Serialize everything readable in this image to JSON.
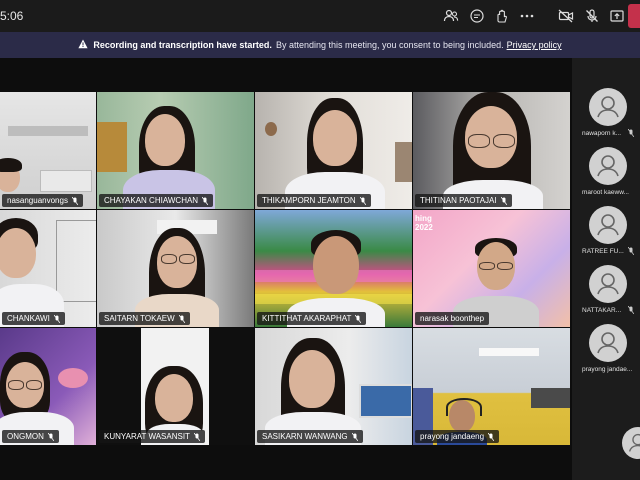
{
  "meeting": {
    "timer": "5:06",
    "banner_title": "Recording and transcription have started.",
    "banner_text": "By attending this meeting, you consent to being included.",
    "banner_link": "Privacy policy"
  },
  "toolbar": {
    "icons": [
      "people-icon",
      "chat-icon",
      "react-icon",
      "more-icon",
      "camera-off-icon",
      "mic-off-icon",
      "share-icon"
    ]
  },
  "tiles": [
    {
      "name": "nasanguanvongs"
    },
    {
      "name": "CHAYAKAN CHIAWCHAN"
    },
    {
      "name": "THIKAMPORN JEAMTON"
    },
    {
      "name": "THITINAN PAOTAJAI"
    },
    {
      "name": "CHANKAWI"
    },
    {
      "name": "SAITARN TOKAEW"
    },
    {
      "name": "KITTITHAT AKARAPHAT"
    },
    {
      "name": "narasak boonthep"
    },
    {
      "name": "ONGMON"
    },
    {
      "name": "KUNYARAT WASANSIT"
    },
    {
      "name": "SASIKARN WANWANG"
    },
    {
      "name": "prayong jandaeng"
    }
  ],
  "sidebar": {
    "participants": [
      {
        "name": "nawaporn k..."
      },
      {
        "name": "maroot kaeww..."
      },
      {
        "name": "RATREE FU..."
      },
      {
        "name": "NATTAKAR..."
      },
      {
        "name": "prayong jandae..."
      }
    ]
  },
  "tile_text": {
    "banner_small": "hing",
    "year": "2022"
  },
  "colors": {
    "topbar": "#1b1b1b",
    "banner": "#2b2b48",
    "leave": "#c4314b",
    "stage": "#0d0d0d"
  }
}
